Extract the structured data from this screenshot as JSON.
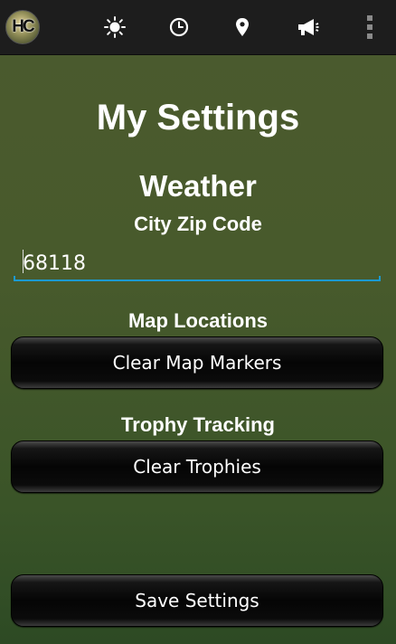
{
  "actionbar": {
    "logo_text": "HC",
    "icons": [
      "sun-icon",
      "clock-icon",
      "location-pin-icon",
      "megaphone-icon",
      "overflow-menu-icon"
    ]
  },
  "page": {
    "title": "My Settings",
    "weather_heading": "Weather",
    "zip_label": "City Zip Code",
    "zip_value": "68118",
    "map_heading": "Map Locations",
    "clear_map_button": "Clear Map Markers",
    "trophy_heading": "Trophy Tracking",
    "clear_trophies_button": "Clear Trophies",
    "save_button": "Save Settings"
  },
  "colors": {
    "accent": "#1b9ad1",
    "background": "#4b5a2e",
    "actionbar": "#1d1d1d"
  }
}
